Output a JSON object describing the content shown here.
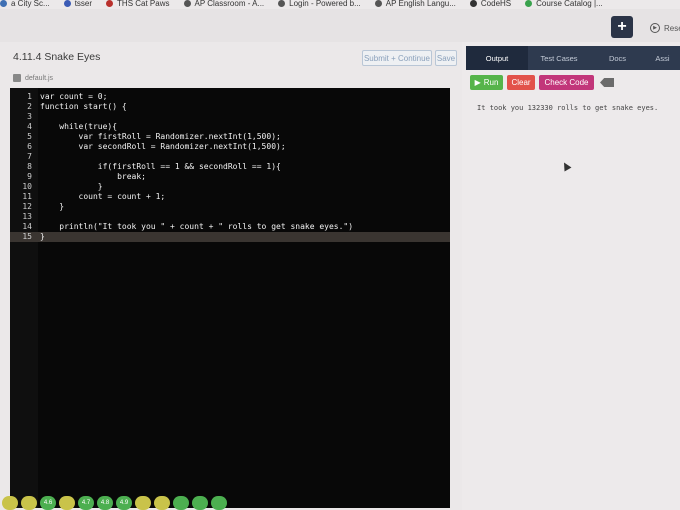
{
  "bookmarks": [
    {
      "label": "a City Sc...",
      "color": "#3f6fb3"
    },
    {
      "label": "tsser",
      "color": "#3b5bb5"
    },
    {
      "label": "THS Cat Paws",
      "color": "#b9302c"
    },
    {
      "label": "AP Classroom - A...",
      "color": "#555555"
    },
    {
      "label": "Login - Powered b...",
      "color": "#555555"
    },
    {
      "label": "AP English Langu...",
      "color": "#555555"
    },
    {
      "label": "CodeHS",
      "color": "#333333"
    },
    {
      "label": "Course Catalog |...",
      "color": "#3aa24d"
    }
  ],
  "header": {
    "plus_label": "+",
    "reset_label": "Rese"
  },
  "editor": {
    "title": "4.11.4 Snake Eyes",
    "submit_label": "Submit + Continue",
    "save_label": "Save",
    "file_tab": "default.js",
    "lines": [
      {
        "n": "1",
        "text": "var count = 0;"
      },
      {
        "n": "2",
        "text": "function start() {"
      },
      {
        "n": "3",
        "text": ""
      },
      {
        "n": "4",
        "text": "    while(true){"
      },
      {
        "n": "5",
        "text": "        var firstRoll = Randomizer.nextInt(1,500);"
      },
      {
        "n": "6",
        "text": "        var secondRoll = Randomizer.nextInt(1,500);"
      },
      {
        "n": "7",
        "text": ""
      },
      {
        "n": "8",
        "text": "            if(firstRoll == 1 && secondRoll == 1){"
      },
      {
        "n": "9",
        "text": "                break;"
      },
      {
        "n": "10",
        "text": "            }"
      },
      {
        "n": "11",
        "text": "        count = count + 1;"
      },
      {
        "n": "12",
        "text": "    }"
      },
      {
        "n": "13",
        "text": ""
      },
      {
        "n": "14",
        "text": "    println(\"It took you \" + count + \" rolls to get snake eyes.\")"
      },
      {
        "n": "15",
        "text": "}"
      }
    ],
    "active_line": "15"
  },
  "output": {
    "tabs": [
      "Output",
      "Test Cases",
      "Docs",
      "Assi"
    ],
    "active_tab": "Output",
    "run_label": "Run",
    "clear_label": "Clear",
    "check_label": "Check Code",
    "text": "It took you 132330 rolls to get snake eyes."
  },
  "progress": [
    {
      "label": "",
      "color": "#c9c34a"
    },
    {
      "label": "",
      "color": "#c9c34a"
    },
    {
      "label": "4.6",
      "color": "#4caf50"
    },
    {
      "label": "",
      "color": "#c9c34a"
    },
    {
      "label": "4.7",
      "color": "#4caf50"
    },
    {
      "label": "4.8",
      "color": "#4caf50"
    },
    {
      "label": "4.9",
      "color": "#4caf50"
    },
    {
      "label": "",
      "color": "#c9c34a"
    },
    {
      "label": "",
      "color": "#c9c34a"
    },
    {
      "label": "",
      "color": "#4caf50"
    },
    {
      "label": "",
      "color": "#4caf50"
    },
    {
      "label": "",
      "color": "#4caf50"
    }
  ]
}
